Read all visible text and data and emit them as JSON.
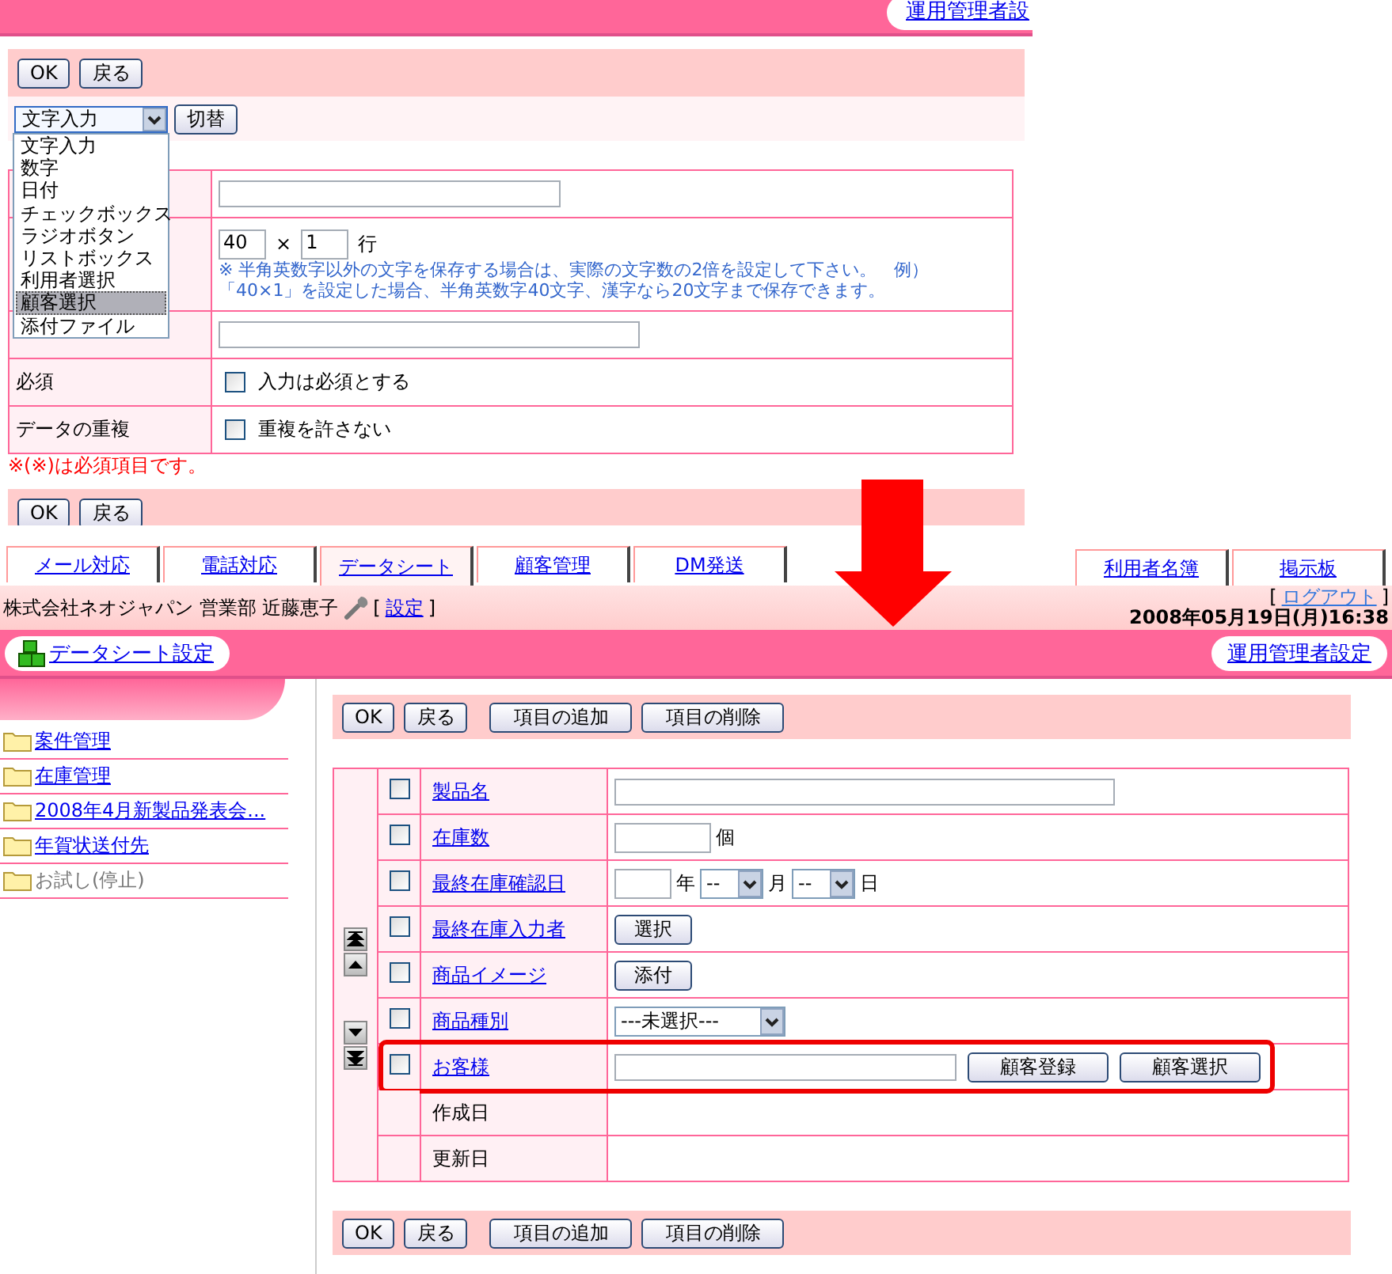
{
  "top_panel": {
    "header_link": "運用管理者設",
    "top_buttons": [
      "OK",
      "戻る"
    ],
    "type_select": {
      "value": "文字入力",
      "expanded": true
    },
    "switch_button": "切替",
    "type_options": [
      {
        "label": "文字入力",
        "selected": false
      },
      {
        "label": "数字",
        "selected": false
      },
      {
        "label": "日付",
        "selected": false
      },
      {
        "label": "チェックボックス",
        "selected": false
      },
      {
        "label": "ラジオボタン",
        "selected": false
      },
      {
        "label": "リストボックス",
        "selected": false
      },
      {
        "label": "利用者選択",
        "selected": false
      },
      {
        "label": "顧客選択",
        "selected": true
      },
      {
        "label": "添付ファイル",
        "selected": false
      }
    ],
    "form_rows": [
      {
        "kind": "text"
      },
      {
        "kind": "size",
        "cols": "40",
        "times": "×",
        "rows": "1",
        "unit": "行",
        "note_lines": [
          "※ 半角英数字以外の文字を保存する場合は、実際の文字数の2倍を設定して下さい。　例）",
          "「40×1」を設定した場合、半角英数字40文字、漢字なら20文字まで保存できます。"
        ]
      },
      {
        "kind": "memo"
      },
      {
        "kind": "checkbox",
        "label": "必須",
        "option": "入力は必須とする",
        "checked": false
      },
      {
        "kind": "checkbox",
        "label": "データの重複",
        "option": "重複を許さない",
        "checked": false
      }
    ],
    "required_note": "※(※)は必須項目です。",
    "bottom_buttons": [
      "OK",
      "戻る"
    ]
  },
  "bottom_panel": {
    "tabs_left": [
      {
        "label": "メール対応",
        "selected": false
      },
      {
        "label": "電話対応",
        "selected": false
      },
      {
        "label": "データシート",
        "selected": true
      },
      {
        "label": "顧客管理",
        "selected": false
      },
      {
        "label": "DM発送",
        "selected": false
      }
    ],
    "tabs_right": [
      {
        "label": "利用者名簿",
        "selected": false
      },
      {
        "label": "掲示板",
        "selected": false
      }
    ],
    "user_line": "株式会社ネオジャパン 営業部 近藤恵子",
    "settings_link": {
      "open": "[",
      "label": "設定",
      "close": "]"
    },
    "logout_link": {
      "open": "[",
      "label": "ログアウト",
      "close": "]"
    },
    "datetime": "2008年05月19日(月)16:38",
    "datasheet_settings_link": "データシート設定",
    "admin_settings_link": "運用管理者設定",
    "sidebar_items": [
      {
        "label": "案件管理",
        "disabled": false
      },
      {
        "label": "在庫管理",
        "disabled": false
      },
      {
        "label": "2008年4月新製品発表会...",
        "disabled": false
      },
      {
        "label": "年賀状送付先",
        "disabled": false
      },
      {
        "label": "お試し(停止)",
        "disabled": true
      }
    ],
    "top_buttons": [
      "OK",
      "戻る",
      "項目の追加",
      "項目の削除"
    ],
    "rows": [
      {
        "kind": "text",
        "label": "製品名",
        "checked": false,
        "highlighted": false
      },
      {
        "kind": "number",
        "label": "在庫数",
        "unit": "個",
        "checked": false,
        "highlighted": false
      },
      {
        "kind": "date",
        "label": "最終在庫確認日",
        "year_unit": "年",
        "month": "--",
        "month_unit": "月",
        "day": "--",
        "day_unit": "日",
        "checked": false,
        "highlighted": false
      },
      {
        "kind": "user",
        "label": "最終在庫入力者",
        "button": "選択",
        "checked": false,
        "highlighted": false
      },
      {
        "kind": "file",
        "label": "商品イメージ",
        "button": "添付",
        "checked": false,
        "highlighted": false
      },
      {
        "kind": "select",
        "label": "商品種別",
        "value": "---未選択---",
        "checked": false,
        "highlighted": false
      },
      {
        "kind": "customer",
        "label": "お客様",
        "buttons": [
          "顧客登録",
          "顧客選択"
        ],
        "checked": false,
        "highlighted": true
      },
      {
        "kind": "system",
        "label": "作成日"
      },
      {
        "kind": "system",
        "label": "更新日"
      }
    ],
    "bottom_buttons": [
      "OK",
      "戻る",
      "項目の追加",
      "項目の削除"
    ]
  }
}
